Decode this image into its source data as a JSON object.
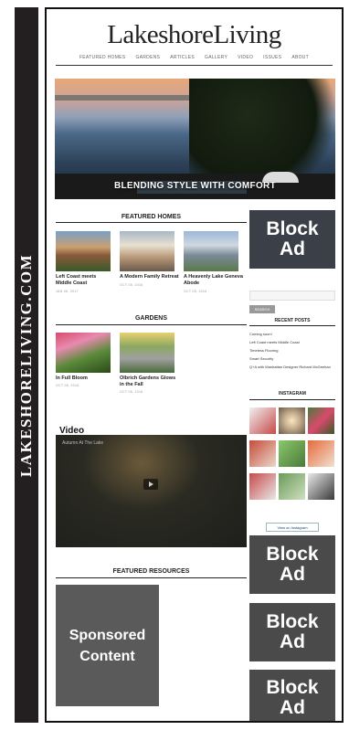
{
  "spine": {
    "text": "LAKESHORELIVING.COM"
  },
  "site": {
    "logo": "LakeshoreLiving"
  },
  "nav": [
    "FEATURED HOMES",
    "GARDENS",
    "ARTICLES",
    "GALLERY",
    "VIDEO",
    "ISSUES",
    "ABOUT"
  ],
  "hero": {
    "title": "BLENDING STYLE WITH COMFORT"
  },
  "featured_homes": {
    "title": "FEATURED HOMES",
    "cards": [
      {
        "title": "Left Coast meets Middle Coast",
        "date": "JAN 06, 2017"
      },
      {
        "title": "A Modern Family Retreat",
        "date": "OCT 05, 2016"
      },
      {
        "title": "A Heavenly Lake Geneva Abode",
        "date": "OCT 05, 2016"
      }
    ]
  },
  "gardens": {
    "title": "GARDENS",
    "cards": [
      {
        "title": "In Full Bloom",
        "date": "OCT 05, 2016"
      },
      {
        "title": "Olbrich Gardens Glows in the Fall",
        "date": "OCT 05, 2016"
      }
    ]
  },
  "video": {
    "heading": "Video",
    "clip_title": "Autumn At The Lake"
  },
  "featured_resources": {
    "title": "FEATURED RESOURCES",
    "sponsored_label": "Sponsored Content"
  },
  "sidebar": {
    "block_ad_label": "Block Ad",
    "search_button": "SEARCH",
    "recent_posts_title": "RECENT POSTS",
    "recent_posts": [
      "Coming soon!",
      "Left Coast meets Middle Coast",
      "Timeless Flooring",
      "Smart Security",
      "Q+A with Manhattan Designer Richard McGeehan"
    ],
    "instagram_title": "INSTAGRAM",
    "instagram_button": "View on Instagram"
  },
  "colors": {
    "spine": "#231f20",
    "block_ad": "#4a4a4a",
    "border": "#111111"
  }
}
